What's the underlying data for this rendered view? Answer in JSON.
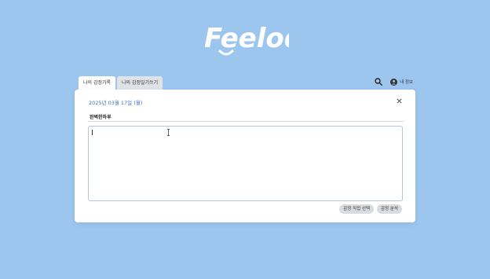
{
  "brand": {
    "logo_text": "Feelody",
    "logo_color": "#ffffff"
  },
  "tabs": [
    {
      "label": "나의 감정기록",
      "active": true
    },
    {
      "label": "나의 감정일기쓰기",
      "active": false
    }
  ],
  "header": {
    "search_icon": "search-icon",
    "account_icon": "user-circle-icon",
    "account_label": "내 정보"
  },
  "editor": {
    "date": "2025년 03월 17일 (월)",
    "close_icon": "close-icon",
    "title_value": "완벽한하루",
    "body_value": "",
    "buttons": {
      "manual_select": "감정 직접 선택",
      "analyze": "감정 분석"
    }
  },
  "colors": {
    "background": "#9dc6ee",
    "card": "#ffffff",
    "date_text": "#3b73b9",
    "button": "#d8dbe0"
  }
}
